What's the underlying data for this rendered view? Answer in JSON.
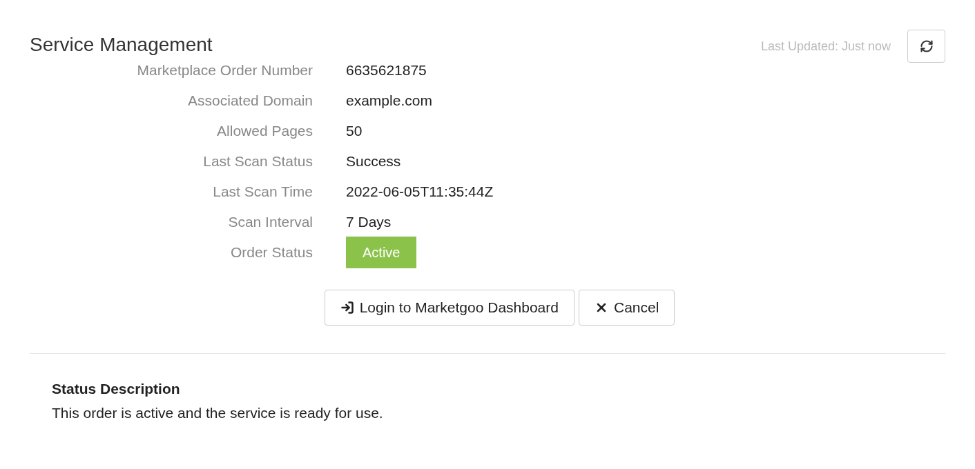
{
  "title": "Service Management",
  "last_updated": "Last Updated: Just now",
  "fields": [
    {
      "label": "Marketplace Order Number",
      "value": "6635621875",
      "kind": "text"
    },
    {
      "label": "Associated Domain",
      "value": "example.com",
      "kind": "text"
    },
    {
      "label": "Allowed Pages",
      "value": "50",
      "kind": "text"
    },
    {
      "label": "Last Scan Status",
      "value": "Success",
      "kind": "text"
    },
    {
      "label": "Last Scan Time",
      "value": "2022-06-05T11:35:44Z",
      "kind": "text"
    },
    {
      "label": "Scan Interval",
      "value": "7 Days",
      "kind": "text"
    },
    {
      "label": "Order Status",
      "value": "Active",
      "kind": "badge",
      "color": "#8bc34a"
    }
  ],
  "buttons": [
    {
      "label": "Login to Marketgoo Dashboard",
      "kind": "login"
    },
    {
      "label": "Cancel",
      "kind": "cancel"
    }
  ],
  "status_description": {
    "heading": "Status Description",
    "text": "This order is active and the service is ready for use."
  }
}
